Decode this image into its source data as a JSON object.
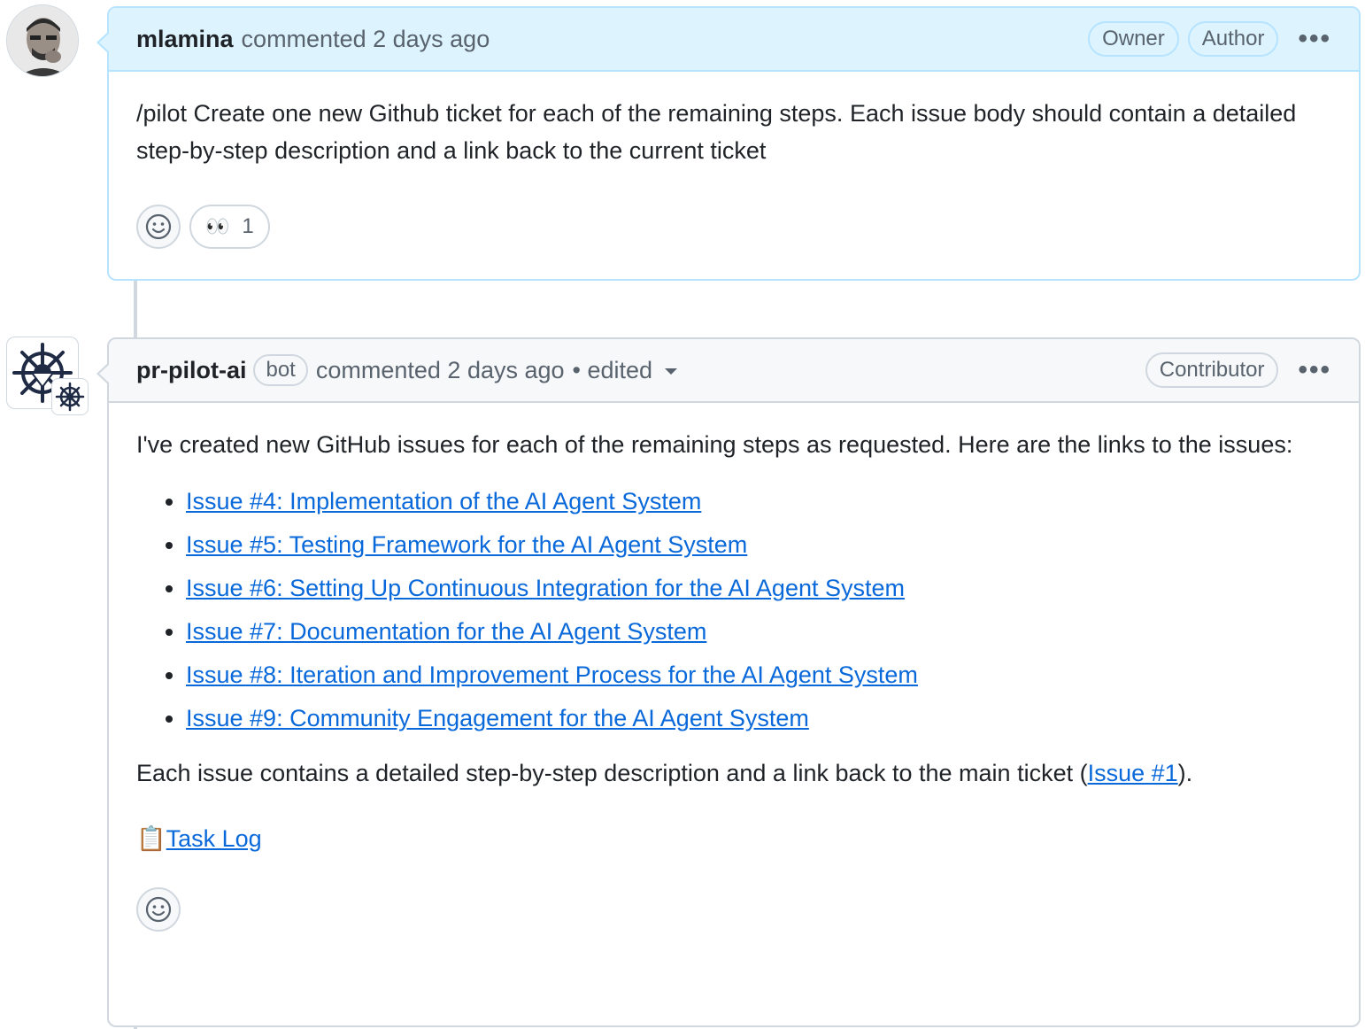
{
  "comments": [
    {
      "author": "mlamina",
      "meta": "commented 2 days ago",
      "roles": [
        "Owner",
        "Author"
      ],
      "body": "/pilot Create one new Github ticket for each of the remaining steps. Each issue body should contain a detailed step-by-step description and a link back to the current ticket",
      "reaction": {
        "emoji": "👀",
        "count": "1"
      }
    },
    {
      "author": "pr-pilot-ai",
      "bot_label": "bot",
      "meta": "commented 2 days ago",
      "edited": "• edited",
      "roles": [
        "Contributor"
      ],
      "intro": "I've created new GitHub issues for each of the remaining steps as requested. Here are the links to the issues:",
      "issues": [
        "Issue #4: Implementation of the AI Agent System",
        "Issue #5: Testing Framework for the AI Agent System",
        "Issue #6: Setting Up Continuous Integration for the AI Agent System",
        "Issue #7: Documentation for the AI Agent System",
        "Issue #8: Iteration and Improvement Process for the AI Agent System",
        "Issue #9: Community Engagement for the AI Agent System"
      ],
      "outro_before": "Each issue contains a detailed step-by-step description and a link back to the main ticket (",
      "outro_link": "Issue #1",
      "outro_after": ").",
      "task_log_icon": "📋",
      "task_log": "Task Log"
    }
  ],
  "icons": {
    "more": "kebab-horizontal-icon",
    "smiley": "smiley-icon"
  },
  "colors": {
    "link": "#0969da",
    "owner_header": "#ddf4ff",
    "owner_border": "#b6e3ff",
    "bot_header": "#f6f8fa",
    "border": "#d0d7de"
  }
}
